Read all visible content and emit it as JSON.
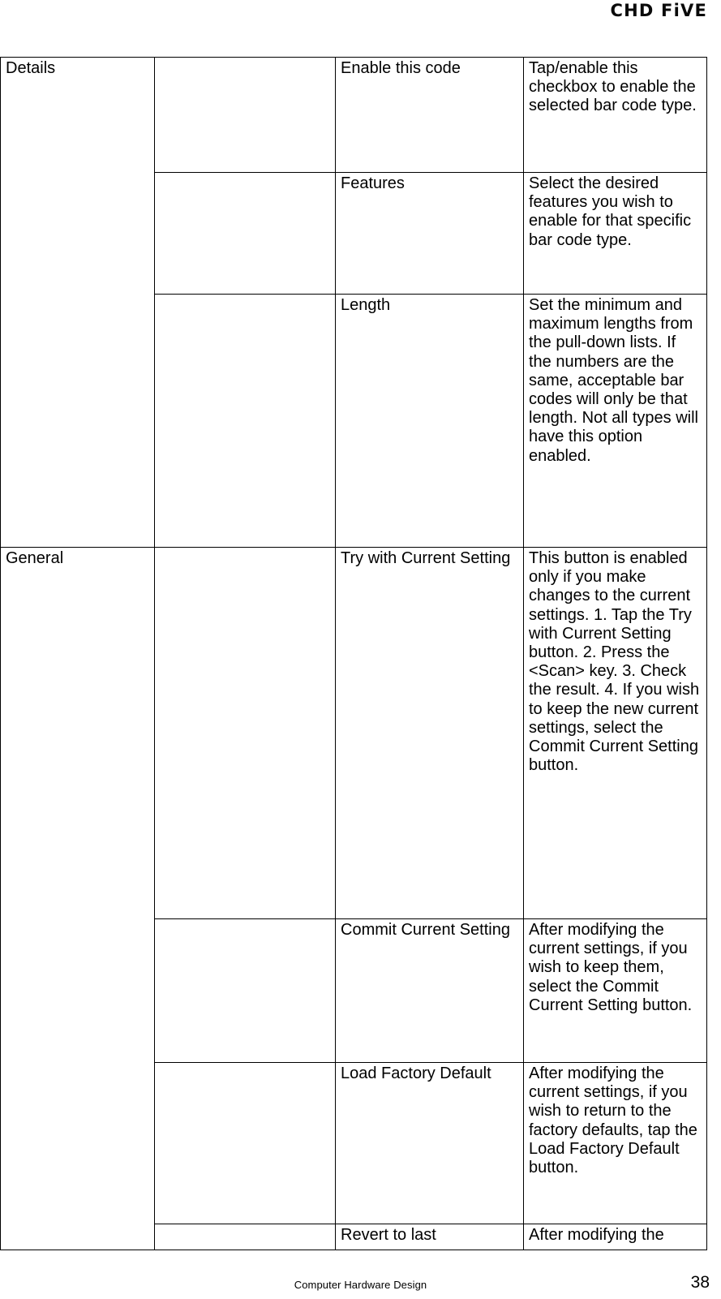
{
  "header": {
    "logo_text": "CHD FiVE"
  },
  "table": {
    "groups": [
      {
        "name": "Details",
        "sub": "",
        "rows": [
          {
            "item": "Enable this code",
            "description": "Tap/enable this checkbox to enable the selected bar code type."
          },
          {
            "item": "Features",
            "description": "Select the desired features you wish to enable for that specific bar code type."
          },
          {
            "item": "Length",
            "description": "Set the minimum and maximum lengths from the pull-down lists. If the numbers are the same, acceptable bar codes will only be that length. Not all types will have this option enabled."
          }
        ]
      },
      {
        "name": "General",
        "sub": "",
        "rows": [
          {
            "item": "Try with Current Setting",
            "description": "This button is enabled only if you make changes to the current settings. 1. Tap the Try with Current Setting button. 2. Press the <Scan> key. 3. Check the result. 4. If you wish to keep the new current settings, select the Commit Current Setting button."
          },
          {
            "item": "Commit Current Setting",
            "description": "After modifying the current settings, if you wish to keep them, select the Commit Current Setting button."
          },
          {
            "item": "Load Factory Default",
            "description": "After modifying the current settings, if you wish to return to the factory defaults, tap the Load Factory Default button."
          },
          {
            "item": "Revert to last",
            "description": "After modifying the"
          }
        ]
      }
    ]
  },
  "footer": {
    "center_text": "Computer Hardware Design",
    "page_number": "38"
  }
}
